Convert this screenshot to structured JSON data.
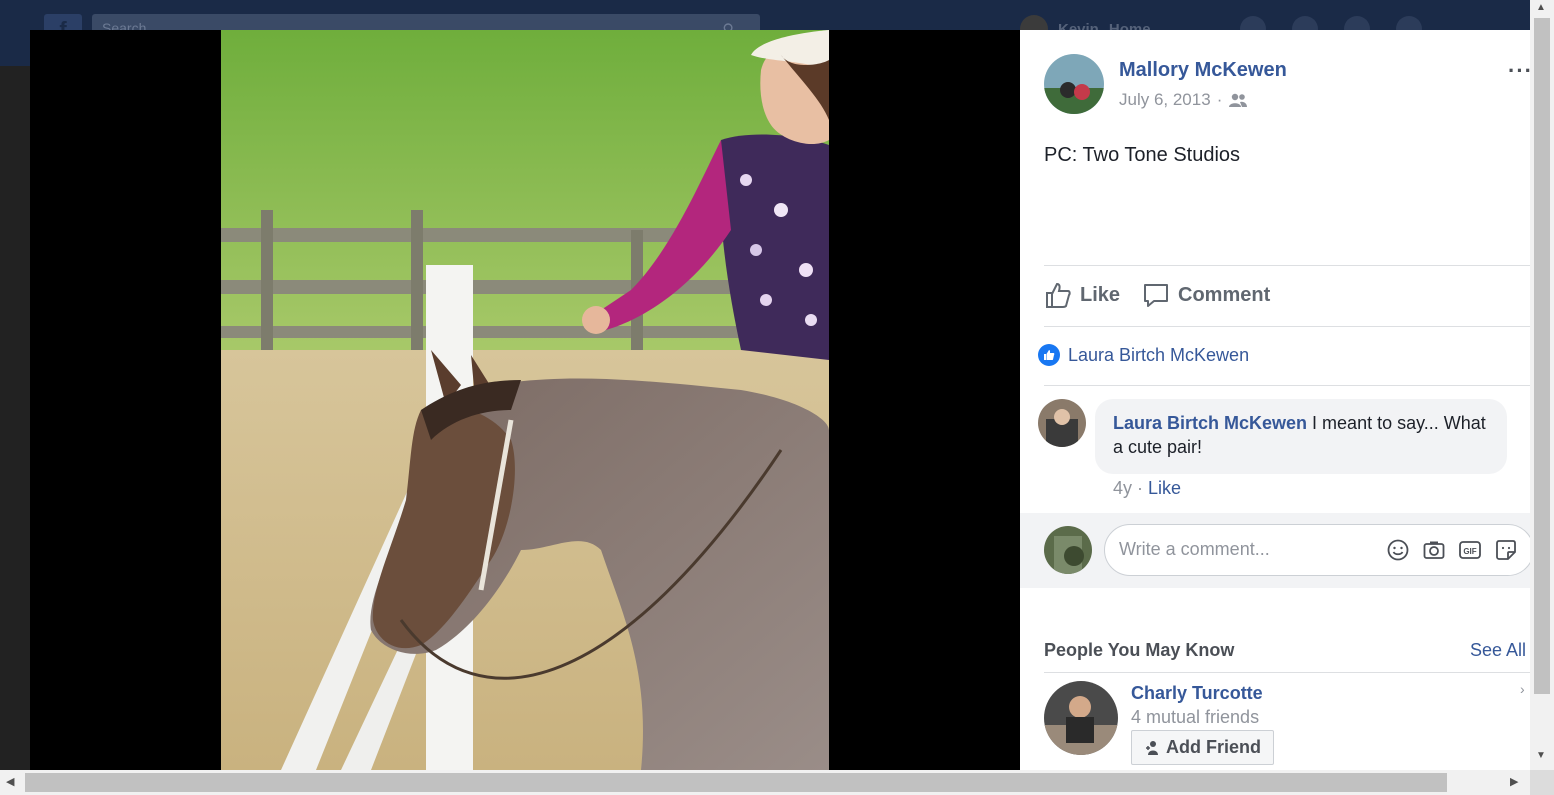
{
  "background": {
    "search_placeholder": "Search",
    "user_name": "Kevin",
    "home_label": "Home"
  },
  "post": {
    "author": "Mallory McKewen",
    "date": "July 6, 2013",
    "separator": "·",
    "audience_icon": "friends-icon",
    "more": "···",
    "text": "PC: Two Tone Studios"
  },
  "actions": {
    "like": "Like",
    "comment": "Comment"
  },
  "likes": {
    "names": "Laura Birtch McKewen"
  },
  "comment": {
    "author": "Laura Birtch McKewen",
    "text": " I meant to say... What a cute pair!",
    "age": "4y",
    "sep": " · ",
    "like": "Like"
  },
  "composer": {
    "placeholder": "Write a comment...",
    "icons": [
      "smiley-icon",
      "camera-icon",
      "gif-icon",
      "sticker-icon"
    ]
  },
  "pymk": {
    "title": "People You May Know",
    "see_all": "See All",
    "person": {
      "name": "Charly Turcotte",
      "mutual": "4 mutual friends",
      "add_label": "Add Friend"
    }
  },
  "colors": {
    "link": "#365899",
    "like_badge": "#1877f2",
    "stage": "#000000"
  }
}
